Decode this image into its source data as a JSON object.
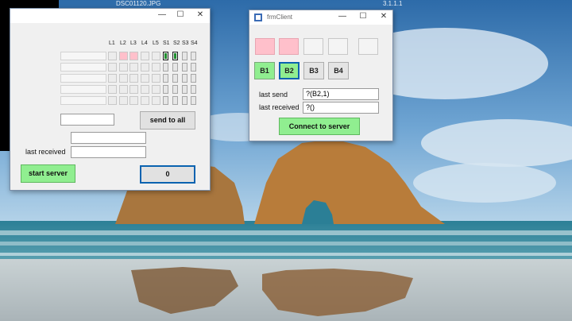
{
  "desktop": {
    "top_left_text": "DSC01120.JPG",
    "top_right_text": "3.1.1.1",
    "colors": {
      "sky": "#3f7fbb",
      "sea": "#2f6f87",
      "sand": "#b8c0c3",
      "rock": "#b87c3a"
    }
  },
  "server": {
    "col_headers": [
      "L1",
      "L2",
      "L3",
      "L4",
      "L5",
      "S1",
      "S2",
      "S3",
      "S4"
    ],
    "last_received_label": "last received",
    "send_to_all_label": "send to all",
    "start_server_label": "start server",
    "counter_label": "0",
    "active_small_cells": [
      1,
      2
    ],
    "active_tall_cells": [
      1,
      2
    ]
  },
  "client": {
    "title": "frmClient",
    "buttons": [
      "B1",
      "B2",
      "B3",
      "B4"
    ],
    "last_send_label": "last send",
    "last_send_value": "?(B2,1)",
    "last_received_label": "last received",
    "last_received_value": "?()",
    "connect_label": "Connect to server",
    "colors": {
      "pink": "#ffc0cb",
      "green": "#90ee90",
      "active_border": "#0a63b0"
    }
  },
  "window_controls": {
    "minimize": "—",
    "maximize": "☐",
    "close": "✕"
  }
}
